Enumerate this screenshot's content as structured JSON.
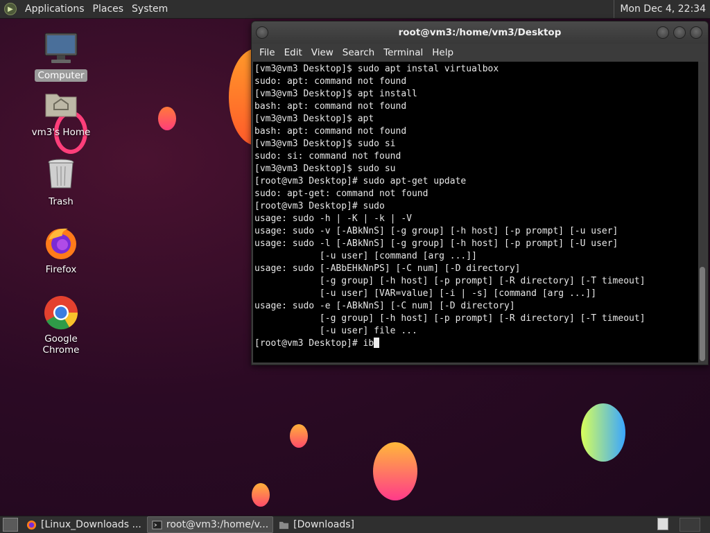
{
  "top_panel": {
    "menus": [
      "Applications",
      "Places",
      "System"
    ],
    "clock": "Mon Dec  4, 22:34"
  },
  "desktop_icons": [
    {
      "label": "Computer"
    },
    {
      "label": "vm3's Home"
    },
    {
      "label": "Trash"
    },
    {
      "label": "Firefox"
    },
    {
      "label": "Google Chrome"
    }
  ],
  "terminal": {
    "title": "root@vm3:/home/vm3/Desktop",
    "menu": [
      "File",
      "Edit",
      "View",
      "Search",
      "Terminal",
      "Help"
    ],
    "lines": [
      "[vm3@vm3 Desktop]$ sudo apt instal virtualbox",
      "sudo: apt: command not found",
      "[vm3@vm3 Desktop]$ apt install",
      "bash: apt: command not found",
      "[vm3@vm3 Desktop]$ apt",
      "bash: apt: command not found",
      "[vm3@vm3 Desktop]$ sudo si",
      "sudo: si: command not found",
      "[vm3@vm3 Desktop]$ sudo su",
      "[root@vm3 Desktop]# sudo apt-get update",
      "sudo: apt-get: command not found",
      "[root@vm3 Desktop]# sudo",
      "usage: sudo -h | -K | -k | -V",
      "usage: sudo -v [-ABkNnS] [-g group] [-h host] [-p prompt] [-u user]",
      "usage: sudo -l [-ABkNnS] [-g group] [-h host] [-p prompt] [-U user]",
      "            [-u user] [command [arg ...]]",
      "usage: sudo [-ABbEHkNnPS] [-C num] [-D directory]",
      "            [-g group] [-h host] [-p prompt] [-R directory] [-T timeout]",
      "            [-u user] [VAR=value] [-i | -s] [command [arg ...]]",
      "usage: sudo -e [-ABkNnS] [-C num] [-D directory]",
      "            [-g group] [-h host] [-p prompt] [-R directory] [-T timeout]",
      "            [-u user] file ..."
    ],
    "prompt": "[root@vm3 Desktop]# ",
    "input": "ib"
  },
  "taskbar": {
    "tasks": [
      {
        "label": "[Linux_Downloads ..."
      },
      {
        "label": "root@vm3:/home/v..."
      },
      {
        "label": "[Downloads]"
      }
    ]
  },
  "colors": {
    "desktop_bg": "#2b0a24",
    "panel": "#2f2f2f",
    "terminal_bg": "#000000"
  }
}
